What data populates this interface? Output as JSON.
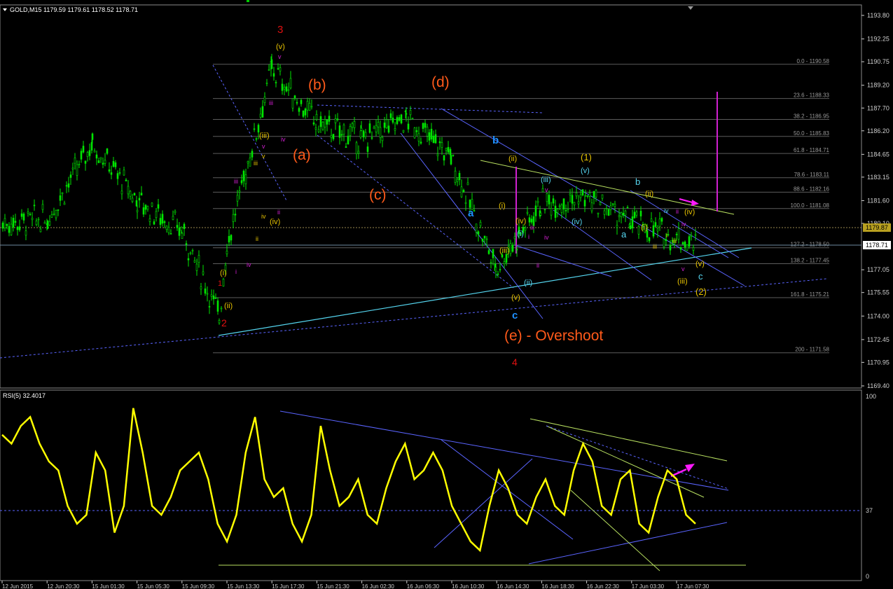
{
  "price_panel": {
    "header": "GOLD,M15  1179.59 1179.61 1178.52 1178.71",
    "current_price": "1178.71",
    "upper_line_price": "1179.87",
    "y_axis_labels": [
      "1193.80",
      "1192.25",
      "1190.75",
      "1189.20",
      "1187.70",
      "1186.20",
      "1184.65",
      "1183.15",
      "1181.60",
      "1180.10",
      "1177.05",
      "1175.55",
      "1174.00",
      "1172.45",
      "1170.95",
      "1169.40"
    ]
  },
  "fibonacci": {
    "levels": [
      {
        "label": "0.0 - 1190.58",
        "price": 1190.58
      },
      {
        "label": "23.6 - 1188.33",
        "price": 1188.33
      },
      {
        "label": "38.2 - 1186.95",
        "price": 1186.95
      },
      {
        "label": "50.0 - 1185.83",
        "price": 1185.83
      },
      {
        "label": "61.8 - 1184.71",
        "price": 1184.71
      },
      {
        "label": "78.6 - 1183.11",
        "price": 1183.11
      },
      {
        "label": "88.6 - 1182.16",
        "price": 1182.16
      },
      {
        "label": "100.0 - 1181.08",
        "price": 1181.08
      },
      {
        "label": "127.2 - 1178.50",
        "price": 1178.5
      },
      {
        "label": "138.2 - 1177.45",
        "price": 1177.45
      },
      {
        "label": "161.8 - 1175.21",
        "price": 1175.21
      },
      {
        "label": "200 - 1171.58",
        "price": 1171.58
      }
    ]
  },
  "wave_labels": {
    "big_3": "3",
    "big_2": "2",
    "big_4": "4",
    "wave_a": "(a)",
    "wave_b": "(b)",
    "wave_c": "(c)",
    "wave_d": "(d)",
    "wave_e": "(e) - Overshoot",
    "blue_a": "a",
    "blue_b": "b",
    "blue_c": "c",
    "y_i": "(i)",
    "y_ii": "(ii)",
    "y_iii": "(iii)",
    "y_iv": "(iv)",
    "y_v": "(v)",
    "c_1": "(1)",
    "c_2": "(2)",
    "c_a": "a",
    "c_b": "b",
    "c_c": "c",
    "m_i": "i",
    "m_ii": "ii",
    "m_iii": "iii",
    "m_iv": "iv",
    "m_v": "v"
  },
  "rsi_panel": {
    "header": "RSI(5) 32.4017",
    "level_high": "100",
    "level_mid": "37",
    "level_low": "0"
  },
  "x_axis_labels": [
    "12 Jun 2015",
    "12 Jun 20:30",
    "15 Jun 01:30",
    "15 Jun 05:30",
    "15 Jun 09:30",
    "15 Jun 13:30",
    "15 Jun 17:30",
    "15 Jun 21:30",
    "16 Jun 02:30",
    "16 Jun 06:30",
    "16 Jun 10:30",
    "16 Jun 14:30",
    "16 Jun 18:30",
    "16 Jun 22:30",
    "17 Jun 03:30",
    "17 Jun 07:30"
  ],
  "colors": {
    "background": "#000000",
    "candles": "#00e600",
    "grid": "#808080",
    "fib": "#6e6e6e",
    "rsi_line": "#ffff00",
    "wave_orange": "#ff5a1a",
    "wave_red": "#e01010",
    "wave_blue": "#1e90ff",
    "wave_yellow": "#e6c200",
    "wave_magenta": "#d020d0",
    "trend_blue": "#5a64ff",
    "trend_cyan": "#55d6f0",
    "trend_green": "#b8e060",
    "arrow": "#ff1aff"
  },
  "chart_data": [
    {
      "type": "candlestick",
      "title": "GOLD,M15",
      "ylim": [
        1169.4,
        1193.8
      ],
      "price_path": [
        {
          "x": "12 Jun 2015",
          "y": 1180.1
        },
        {
          "x": "12 Jun 20:30",
          "y": 1180.4
        },
        {
          "x": "15 Jun 01:30",
          "y": 1185.4
        },
        {
          "x": "15 Jun 05:30",
          "y": 1181.6
        },
        {
          "x": "15 Jun 09:30",
          "y": 1179.6
        },
        {
          "x": "15 Jun 11:00",
          "y": 1174.0
        },
        {
          "x": "15 Jun 13:30",
          "y": 1178.6
        },
        {
          "x": "15 Jun 17:30",
          "y": 1190.3
        },
        {
          "x": "15 Jun 21:30",
          "y": 1186.7
        },
        {
          "x": "16 Jun 02:30",
          "y": 1185.6
        },
        {
          "x": "16 Jun 06:30",
          "y": 1187.0
        },
        {
          "x": "16 Jun 10:30",
          "y": 1184.5
        },
        {
          "x": "16 Jun 14:30",
          "y": 1177.2
        },
        {
          "x": "16 Jun 18:30",
          "y": 1181.4
        },
        {
          "x": "16 Jun 22:30",
          "y": 1181.8
        },
        {
          "x": "17 Jun 03:30",
          "y": 1180.2
        },
        {
          "x": "17 Jun 07:30",
          "y": 1178.71
        }
      ]
    },
    {
      "type": "line",
      "title": "RSI(5) 32.4017",
      "ylim": [
        0,
        100
      ],
      "series": [
        {
          "name": "RSI(5)",
          "values": [
            80,
            75,
            85,
            90,
            75,
            65,
            60,
            40,
            30,
            35,
            70,
            60,
            25,
            40,
            95,
            70,
            40,
            35,
            45,
            60,
            65,
            70,
            55,
            30,
            20,
            35,
            70,
            90,
            55,
            45,
            50,
            30,
            20,
            35,
            85,
            60,
            40,
            45,
            55,
            35,
            30,
            50,
            65,
            75,
            55,
            60,
            70,
            60,
            40,
            30,
            20,
            15,
            40,
            60,
            50,
            35,
            30,
            45,
            55,
            40,
            35,
            60,
            75,
            65,
            40,
            35,
            55,
            60,
            30,
            25,
            45,
            60,
            55,
            35,
            30
          ]
        }
      ]
    }
  ]
}
